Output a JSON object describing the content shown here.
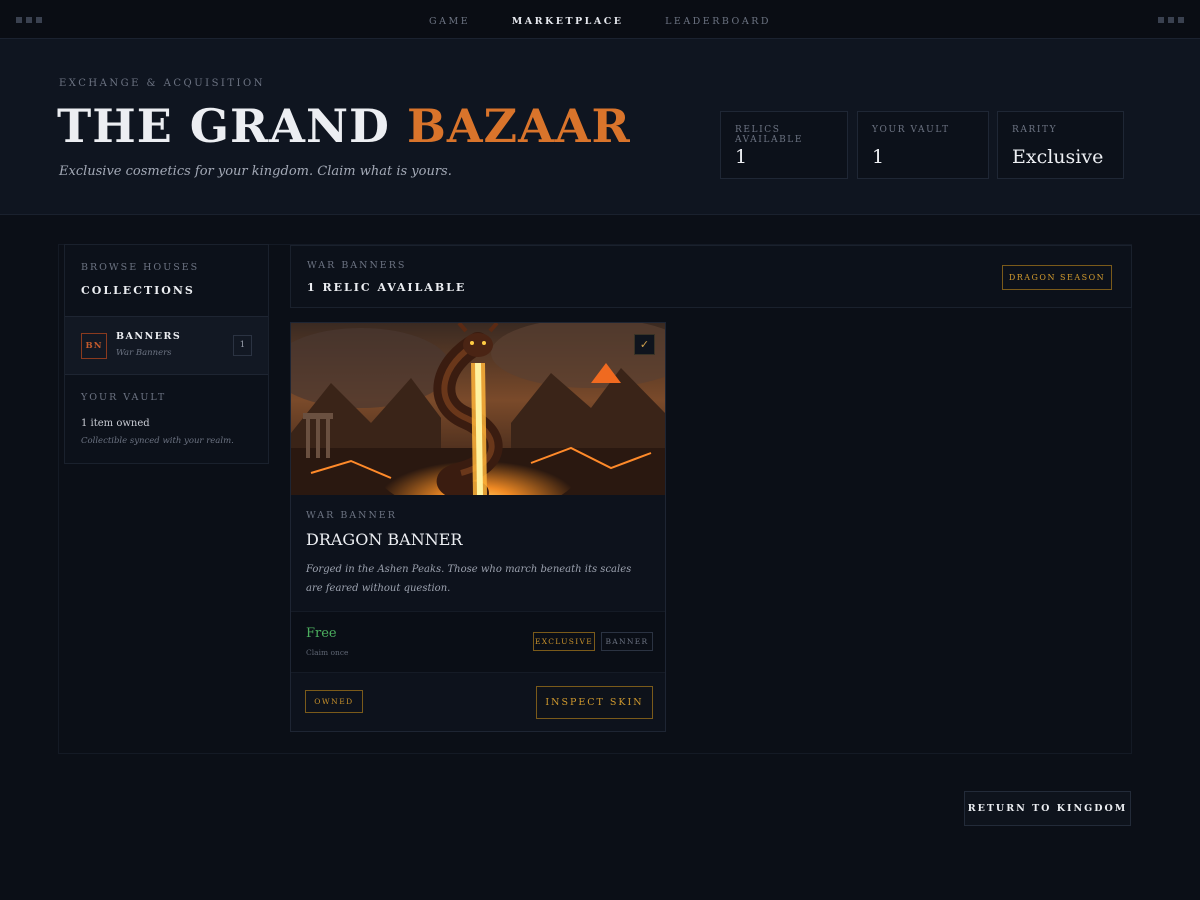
{
  "nav": {
    "items": [
      "GAME",
      "MARKETPLACE",
      "LEADERBOARD"
    ],
    "active": "MARKETPLACE"
  },
  "hero": {
    "eyebrow": "EXCHANGE & ACQUISITION",
    "title_main": "THE GRAND",
    "title_accent": "BAZAAR",
    "subtitle": "Exclusive cosmetics for your kingdom. Claim what is yours."
  },
  "stats": [
    {
      "label": "RELICS AVAILABLE",
      "value": "1"
    },
    {
      "label": "YOUR VAULT",
      "value": "1"
    },
    {
      "label": "RARITY",
      "value": "Exclusive"
    }
  ],
  "sidebar": {
    "browse_label": "BROWSE HOUSES",
    "collections_label": "COLLECTIONS",
    "item": {
      "code": "BN",
      "name": "BANNERS",
      "sub": "War Banners",
      "count": "1"
    },
    "vault_label": "YOUR VAULT",
    "vault_owned": "1 item owned",
    "vault_note": "Collectible synced with your realm."
  },
  "strip": {
    "category": "WAR BANNERS",
    "count": "1 RELIC AVAILABLE",
    "season": "DRAGON SEASON"
  },
  "card": {
    "category": "WAR BANNER",
    "name": "DRAGON BANNER",
    "description": "Forged in the Ashen Peaks. Those who march beneath its scales are feared without question.",
    "price": "Free",
    "price_note": "Claim once",
    "tags": [
      "EXCLUSIVE",
      "BANNER"
    ],
    "owned": "OWNED",
    "inspect": "INSPECT SKIN",
    "check_glyph": "✓"
  },
  "return_label": "RETURN TO KINGDOM",
  "colors": {
    "accent_orange": "#d9742b",
    "gold": "#d19a2e",
    "free_green": "#4caf5f",
    "bg": "#0b0f17"
  }
}
